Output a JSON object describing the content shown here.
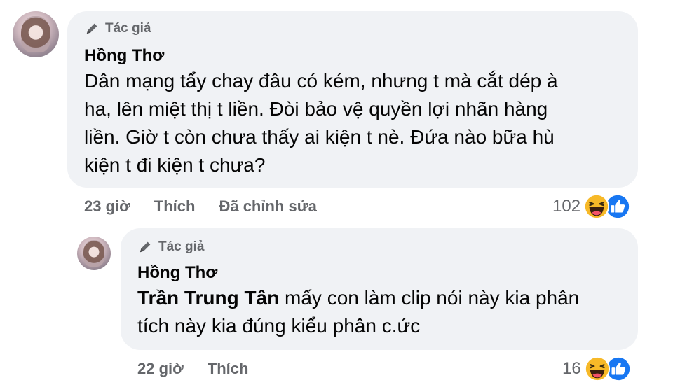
{
  "comment": {
    "badge": "Tác giả",
    "author": "Hồng Thơ",
    "lines": [
      "Dân mạng tẩy chay đâu có kém, nhưng t mà cắt dép à",
      "ha, lên miệt thị t liền. Đòi bảo vệ quyền lợi nhãn hàng",
      "liền. Giờ t còn chưa thấy ai kiện t nè. Đứa nào bữa hù",
      "kiện t đi kiện t chưa?"
    ],
    "time": "23 giờ",
    "like_label": "Thích",
    "edited_label": "Đã chỉnh sửa",
    "reaction_count": "102"
  },
  "reply": {
    "badge": "Tác giả",
    "author": "Hồng Thơ",
    "mention": "Trần Trung Tân",
    "text_line1": " mấy con làm clip nói này kia phân",
    "text_line2": "tích này kia đúng kiểu phân c.ức",
    "time": "22 giờ",
    "like_label": "Thích",
    "reaction_count": "16"
  },
  "colors": {
    "bubble": "#f0f2f5",
    "meta": "#65676b",
    "like_blue": "#1877f2",
    "haha_yellow": "#f7b928"
  },
  "icons": [
    "pencil-icon",
    "haha-reaction-icon",
    "like-reaction-icon"
  ]
}
